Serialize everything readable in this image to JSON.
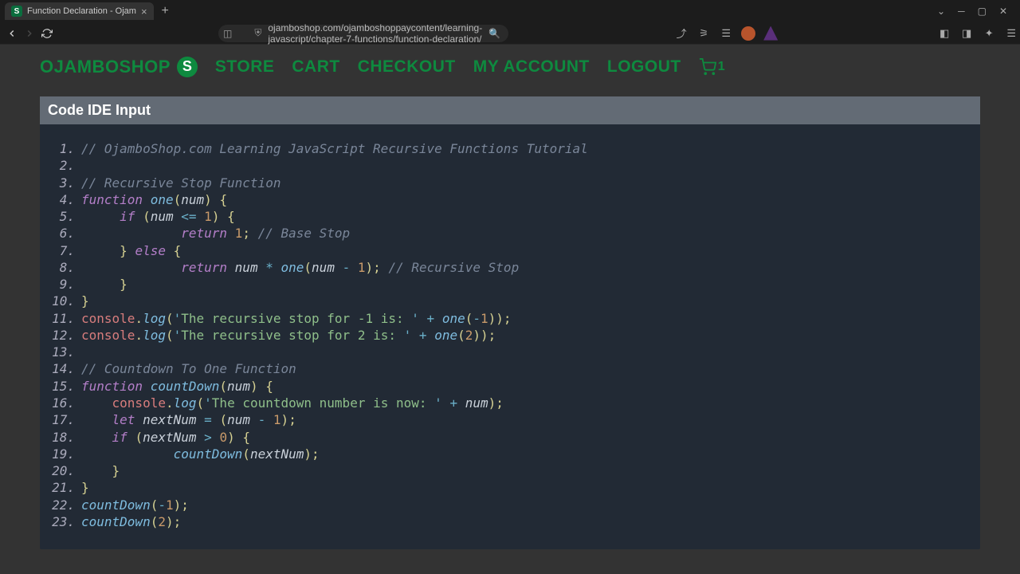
{
  "browser": {
    "tab_title": "Function Declaration - Ojam",
    "url": "ojamboshop.com/ojamboshoppaycontent/learning-javascript/chapter-7-functions/function-declaration/",
    "favicon_letter": "S"
  },
  "site": {
    "logo_text": "OJAMBOSHOP",
    "logo_letter": "S",
    "nav": [
      "STORE",
      "CART",
      "CHECKOUT",
      "MY ACCOUNT",
      "LOGOUT"
    ],
    "cart_count": "1"
  },
  "ide": {
    "title": "Code IDE Input"
  },
  "code": [
    {
      "n": 1,
      "t": [
        {
          "c": "cm",
          "v": "// OjamboShop.com Learning JavaScript Recursive Functions Tutorial"
        }
      ]
    },
    {
      "n": 2,
      "t": []
    },
    {
      "n": 3,
      "t": [
        {
          "c": "cm",
          "v": "// Recursive Stop Function"
        }
      ]
    },
    {
      "n": 4,
      "t": [
        {
          "c": "kw",
          "v": "function"
        },
        {
          "c": "",
          "v": " "
        },
        {
          "c": "fn",
          "v": "one"
        },
        {
          "c": "pn",
          "v": "("
        },
        {
          "c": "id",
          "v": "num"
        },
        {
          "c": "pn",
          "v": ")"
        },
        {
          "c": "",
          "v": " "
        },
        {
          "c": "pn",
          "v": "{"
        }
      ]
    },
    {
      "n": 5,
      "t": [
        {
          "c": "",
          "v": "     "
        },
        {
          "c": "kw",
          "v": "if"
        },
        {
          "c": "",
          "v": " "
        },
        {
          "c": "pn",
          "v": "("
        },
        {
          "c": "id",
          "v": "num"
        },
        {
          "c": "",
          "v": " "
        },
        {
          "c": "op",
          "v": "<="
        },
        {
          "c": "",
          "v": " "
        },
        {
          "c": "nm",
          "v": "1"
        },
        {
          "c": "pn",
          "v": ")"
        },
        {
          "c": "",
          "v": " "
        },
        {
          "c": "pn",
          "v": "{"
        }
      ]
    },
    {
      "n": 6,
      "t": [
        {
          "c": "",
          "v": "             "
        },
        {
          "c": "kw",
          "v": "return"
        },
        {
          "c": "",
          "v": " "
        },
        {
          "c": "nm",
          "v": "1"
        },
        {
          "c": "pn",
          "v": ";"
        },
        {
          "c": "",
          "v": " "
        },
        {
          "c": "cm",
          "v": "// Base Stop"
        }
      ]
    },
    {
      "n": 7,
      "t": [
        {
          "c": "",
          "v": "     "
        },
        {
          "c": "pn",
          "v": "}"
        },
        {
          "c": "",
          "v": " "
        },
        {
          "c": "kw",
          "v": "else"
        },
        {
          "c": "",
          "v": " "
        },
        {
          "c": "pn",
          "v": "{"
        }
      ]
    },
    {
      "n": 8,
      "t": [
        {
          "c": "",
          "v": "             "
        },
        {
          "c": "kw",
          "v": "return"
        },
        {
          "c": "",
          "v": " "
        },
        {
          "c": "id",
          "v": "num"
        },
        {
          "c": "",
          "v": " "
        },
        {
          "c": "op",
          "v": "*"
        },
        {
          "c": "",
          "v": " "
        },
        {
          "c": "fn",
          "v": "one"
        },
        {
          "c": "pn",
          "v": "("
        },
        {
          "c": "id",
          "v": "num"
        },
        {
          "c": "",
          "v": " "
        },
        {
          "c": "op",
          "v": "-"
        },
        {
          "c": "",
          "v": " "
        },
        {
          "c": "nm",
          "v": "1"
        },
        {
          "c": "pn",
          "v": ")"
        },
        {
          "c": "pn",
          "v": ";"
        },
        {
          "c": "",
          "v": " "
        },
        {
          "c": "cm",
          "v": "// Recursive Stop"
        }
      ]
    },
    {
      "n": 9,
      "t": [
        {
          "c": "",
          "v": "     "
        },
        {
          "c": "pn",
          "v": "}"
        }
      ]
    },
    {
      "n": 10,
      "t": [
        {
          "c": "pn",
          "v": "}"
        }
      ]
    },
    {
      "n": 11,
      "t": [
        {
          "c": "obj",
          "v": "console"
        },
        {
          "c": "pn",
          "v": "."
        },
        {
          "c": "fn",
          "v": "log"
        },
        {
          "c": "pn",
          "v": "("
        },
        {
          "c": "st-b",
          "v": "'"
        },
        {
          "c": "st",
          "v": "The recursive stop for -1 is: "
        },
        {
          "c": "st-b",
          "v": "'"
        },
        {
          "c": "",
          "v": " "
        },
        {
          "c": "op",
          "v": "+"
        },
        {
          "c": "",
          "v": " "
        },
        {
          "c": "fn",
          "v": "one"
        },
        {
          "c": "pn",
          "v": "("
        },
        {
          "c": "op",
          "v": "-"
        },
        {
          "c": "nm",
          "v": "1"
        },
        {
          "c": "pn",
          "v": ")"
        },
        {
          "c": "pn",
          "v": ")"
        },
        {
          "c": "pn",
          "v": ";"
        }
      ]
    },
    {
      "n": 12,
      "t": [
        {
          "c": "obj",
          "v": "console"
        },
        {
          "c": "pn",
          "v": "."
        },
        {
          "c": "fn",
          "v": "log"
        },
        {
          "c": "pn",
          "v": "("
        },
        {
          "c": "st-b",
          "v": "'"
        },
        {
          "c": "st",
          "v": "The recursive stop for 2 is: "
        },
        {
          "c": "st-b",
          "v": "'"
        },
        {
          "c": "",
          "v": " "
        },
        {
          "c": "op",
          "v": "+"
        },
        {
          "c": "",
          "v": " "
        },
        {
          "c": "fn",
          "v": "one"
        },
        {
          "c": "pn",
          "v": "("
        },
        {
          "c": "nm",
          "v": "2"
        },
        {
          "c": "pn",
          "v": ")"
        },
        {
          "c": "pn",
          "v": ")"
        },
        {
          "c": "pn",
          "v": ";"
        }
      ]
    },
    {
      "n": 13,
      "t": []
    },
    {
      "n": 14,
      "t": [
        {
          "c": "cm",
          "v": "// Countdown To One Function"
        }
      ]
    },
    {
      "n": 15,
      "t": [
        {
          "c": "kw",
          "v": "function"
        },
        {
          "c": "",
          "v": " "
        },
        {
          "c": "fn",
          "v": "countDown"
        },
        {
          "c": "pn",
          "v": "("
        },
        {
          "c": "id",
          "v": "num"
        },
        {
          "c": "pn",
          "v": ")"
        },
        {
          "c": "",
          "v": " "
        },
        {
          "c": "pn",
          "v": "{"
        }
      ]
    },
    {
      "n": 16,
      "t": [
        {
          "c": "",
          "v": "    "
        },
        {
          "c": "obj",
          "v": "console"
        },
        {
          "c": "pn",
          "v": "."
        },
        {
          "c": "fn",
          "v": "log"
        },
        {
          "c": "pn",
          "v": "("
        },
        {
          "c": "st-b",
          "v": "'"
        },
        {
          "c": "st",
          "v": "The countdown number is now: "
        },
        {
          "c": "st-b",
          "v": "'"
        },
        {
          "c": "",
          "v": " "
        },
        {
          "c": "op",
          "v": "+"
        },
        {
          "c": "",
          "v": " "
        },
        {
          "c": "id",
          "v": "num"
        },
        {
          "c": "pn",
          "v": ")"
        },
        {
          "c": "pn",
          "v": ";"
        }
      ]
    },
    {
      "n": 17,
      "t": [
        {
          "c": "",
          "v": "    "
        },
        {
          "c": "kw",
          "v": "let"
        },
        {
          "c": "",
          "v": " "
        },
        {
          "c": "id",
          "v": "nextNum"
        },
        {
          "c": "",
          "v": " "
        },
        {
          "c": "op",
          "v": "="
        },
        {
          "c": "",
          "v": " "
        },
        {
          "c": "pn",
          "v": "("
        },
        {
          "c": "id",
          "v": "num"
        },
        {
          "c": "",
          "v": " "
        },
        {
          "c": "op",
          "v": "-"
        },
        {
          "c": "",
          "v": " "
        },
        {
          "c": "nm",
          "v": "1"
        },
        {
          "c": "pn",
          "v": ")"
        },
        {
          "c": "pn",
          "v": ";"
        }
      ]
    },
    {
      "n": 18,
      "t": [
        {
          "c": "",
          "v": "    "
        },
        {
          "c": "kw",
          "v": "if"
        },
        {
          "c": "",
          "v": " "
        },
        {
          "c": "pn",
          "v": "("
        },
        {
          "c": "id",
          "v": "nextNum"
        },
        {
          "c": "",
          "v": " "
        },
        {
          "c": "op",
          "v": ">"
        },
        {
          "c": "",
          "v": " "
        },
        {
          "c": "nm",
          "v": "0"
        },
        {
          "c": "pn",
          "v": ")"
        },
        {
          "c": "",
          "v": " "
        },
        {
          "c": "pn",
          "v": "{"
        }
      ]
    },
    {
      "n": 19,
      "t": [
        {
          "c": "",
          "v": "            "
        },
        {
          "c": "fn",
          "v": "countDown"
        },
        {
          "c": "pn",
          "v": "("
        },
        {
          "c": "id",
          "v": "nextNum"
        },
        {
          "c": "pn",
          "v": ")"
        },
        {
          "c": "pn",
          "v": ";"
        }
      ]
    },
    {
      "n": 20,
      "t": [
        {
          "c": "",
          "v": "    "
        },
        {
          "c": "pn",
          "v": "}"
        }
      ]
    },
    {
      "n": 21,
      "t": [
        {
          "c": "pn",
          "v": "}"
        }
      ]
    },
    {
      "n": 22,
      "t": [
        {
          "c": "fn",
          "v": "countDown"
        },
        {
          "c": "pn",
          "v": "("
        },
        {
          "c": "op",
          "v": "-"
        },
        {
          "c": "nm",
          "v": "1"
        },
        {
          "c": "pn",
          "v": ")"
        },
        {
          "c": "pn",
          "v": ";"
        }
      ]
    },
    {
      "n": 23,
      "t": [
        {
          "c": "fn",
          "v": "countDown"
        },
        {
          "c": "pn",
          "v": "("
        },
        {
          "c": "nm",
          "v": "2"
        },
        {
          "c": "pn",
          "v": ")"
        },
        {
          "c": "pn",
          "v": ";"
        }
      ]
    }
  ]
}
